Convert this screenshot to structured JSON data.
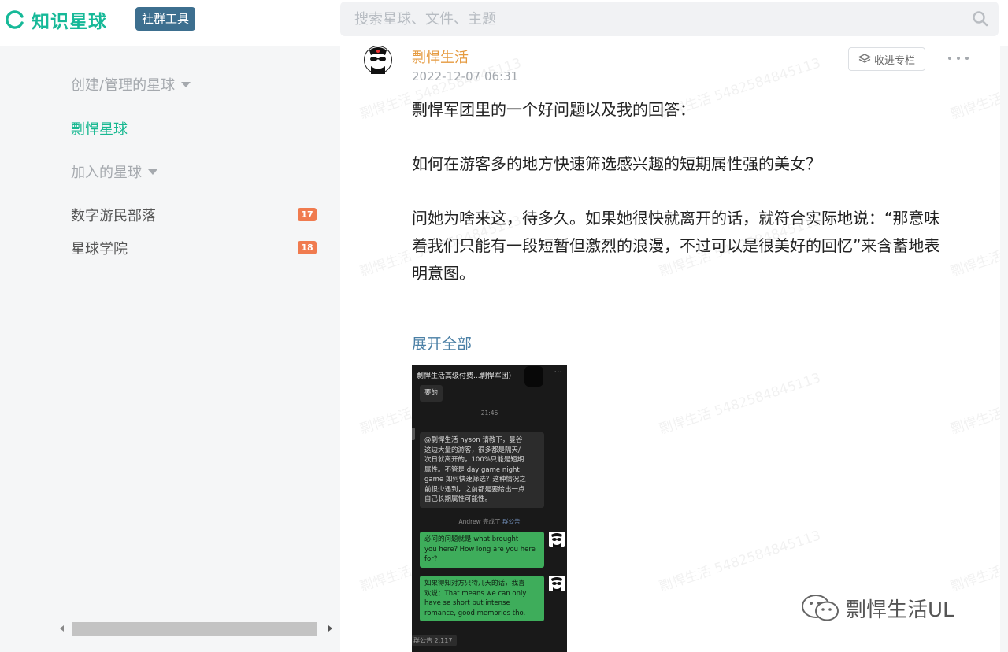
{
  "app": {
    "logo_text": "知识星球",
    "tool_badge": "社群工具",
    "search_placeholder": "搜索星球、文件、主题"
  },
  "sidebar": {
    "created_title": "创建/管理的星球",
    "created_items": [
      {
        "label": "剽悍星球",
        "active": true
      }
    ],
    "joined_title": "加入的星球",
    "joined_items": [
      {
        "label": "数字游民部落",
        "badge": "17"
      },
      {
        "label": "星球学院",
        "badge": "18"
      }
    ]
  },
  "post": {
    "author": "剽悍生活",
    "time": "2022-12-07 06:31",
    "collect_label": "收进专栏",
    "paragraphs": [
      "剽悍军团里的一个好问题以及我的回答：",
      "如何在游客多的地方快速筛选感兴趣的短期属性强的美女？",
      "问她为啥来这，待多久。如果她很快就离开的话，就符合实际地说：“那意味",
      "着我们只能有一段短暂但激烈的浪漫，不过可以是很美好的回忆”来含蓄地表",
      "明意图。"
    ],
    "expand_label": "展开全部",
    "watermark": "剽悍生活 5482584845113",
    "chat_image": {
      "title": "剽悍生活高级付费...剽悍军团)",
      "more": "···",
      "bubble_top": "要的",
      "time": "21:46",
      "question_lines": [
        "@剽悍生活  hyson 请教下，曼谷",
        "这边大量的游客，很多都是隔天/",
        "次日就离开的，100%只能是短期",
        "属性。不管是 day game night",
        "game 如何快速筛选？这种情况之",
        "前很少遇到，之前都是要给出一点",
        "自己长期属性可能性。"
      ],
      "system_prefix": "Andrew 完成了",
      "system_link": "群公告",
      "answer1_lines": [
        "必问的问题就是 what brought",
        "you here? How long are you here",
        "for?"
      ],
      "answer2_lines": [
        "如果得知对方只待几天的话，我喜",
        "欢说：That means we can only",
        "have se short but intense",
        "romance, good memories tho."
      ],
      "footer_chip": "群公告",
      "footer_count": "2,117"
    }
  },
  "wechat_mark": "剽悍生活UL",
  "colors": {
    "brand_green": "#16b998",
    "badge_orange": "#f07b4f",
    "author_orange": "#e59a3f",
    "link_blue": "#4a7fa5"
  }
}
